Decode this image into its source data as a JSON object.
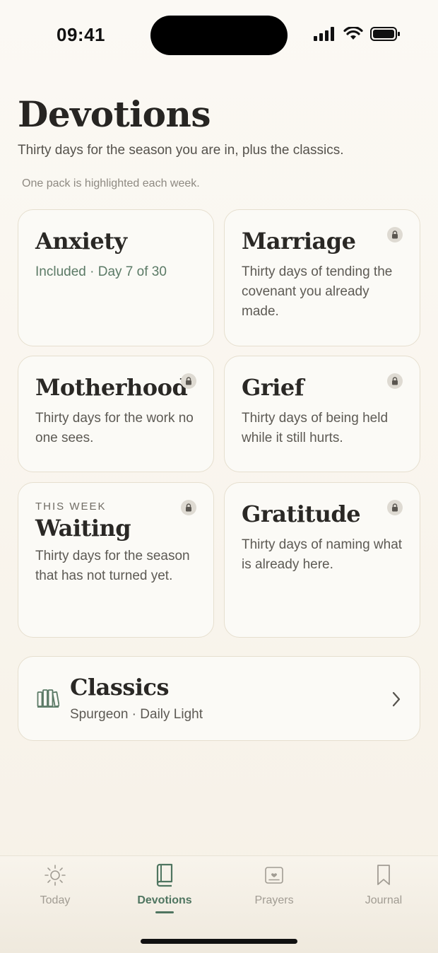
{
  "status_bar": {
    "time": "09:41"
  },
  "header": {
    "title": "Devotions",
    "subtitle": "Thirty days for the season you are in, plus the classics.",
    "note": "One pack is highlighted each week."
  },
  "packs": [
    {
      "title": "Anxiety",
      "status": "Included · Day 7 of 30",
      "locked": false
    },
    {
      "title": "Marriage",
      "description": "Thirty days of tending the covenant you already made.",
      "locked": true
    },
    {
      "title": "Motherhood",
      "description": "Thirty days for the work no one sees.",
      "locked": true
    },
    {
      "title": "Grief",
      "description": "Thirty days of being held while it still hurts.",
      "locked": true
    },
    {
      "kicker": "THIS WEEK",
      "title": "Waiting",
      "description": "Thirty days for the season that has not turned yet.",
      "locked": true
    },
    {
      "title": "Gratitude",
      "description": "Thirty days of naming what is already here.",
      "locked": true
    }
  ],
  "classics": {
    "title": "Classics",
    "subtitle": "Spurgeon · Daily Light",
    "icon": "books-icon"
  },
  "tabs": [
    {
      "label": "Today",
      "icon": "sun-icon",
      "active": false
    },
    {
      "label": "Devotions",
      "icon": "book-icon",
      "active": true
    },
    {
      "label": "Prayers",
      "icon": "prayer-card-icon",
      "active": false
    },
    {
      "label": "Journal",
      "icon": "bookmark-icon",
      "active": false
    }
  ],
  "colors": {
    "accent": "#4f7560",
    "background": "#faf6ef",
    "card_border": "#e6dfcf",
    "title": "#2a2825"
  }
}
